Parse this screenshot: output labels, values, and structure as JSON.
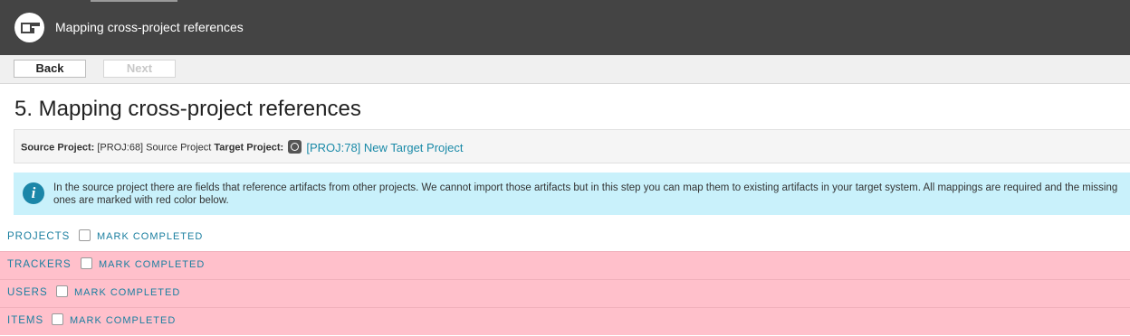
{
  "header": {
    "title": "Mapping cross-project references",
    "logo_icon": "openproject-logo-icon"
  },
  "toolbar": {
    "back_label": "Back",
    "next_label": "Next"
  },
  "page": {
    "title": "5. Mapping cross-project references"
  },
  "project_bar": {
    "source_label": "Source Project:",
    "source_value": "[PROJ:68] Source Project",
    "target_label": "Target Project:",
    "target_icon": "target-project-icon",
    "target_value": "[PROJ:78] New Target Project"
  },
  "info": {
    "icon": "info-icon",
    "text": "In the source project there are fields that reference artifacts from other projects. We cannot import those artifacts but in this step you can map them to existing artifacts in your target system. All mappings are required and the missing ones are marked with red color below."
  },
  "sections": [
    {
      "label": "PROJECTS",
      "mark_label": "MARK COMPLETED",
      "status": "complete"
    },
    {
      "label": "TRACKERS",
      "mark_label": "MARK COMPLETED",
      "status": "missing"
    },
    {
      "label": "USERS",
      "mark_label": "MARK COMPLETED",
      "status": "missing"
    },
    {
      "label": "ITEMS",
      "mark_label": "MARK COMPLETED",
      "status": "missing"
    }
  ],
  "colors": {
    "header_bg": "#444444",
    "info_bg": "#c9f1fb",
    "missing_bg": "#ffc0cb",
    "link": "#1b7fa0"
  }
}
